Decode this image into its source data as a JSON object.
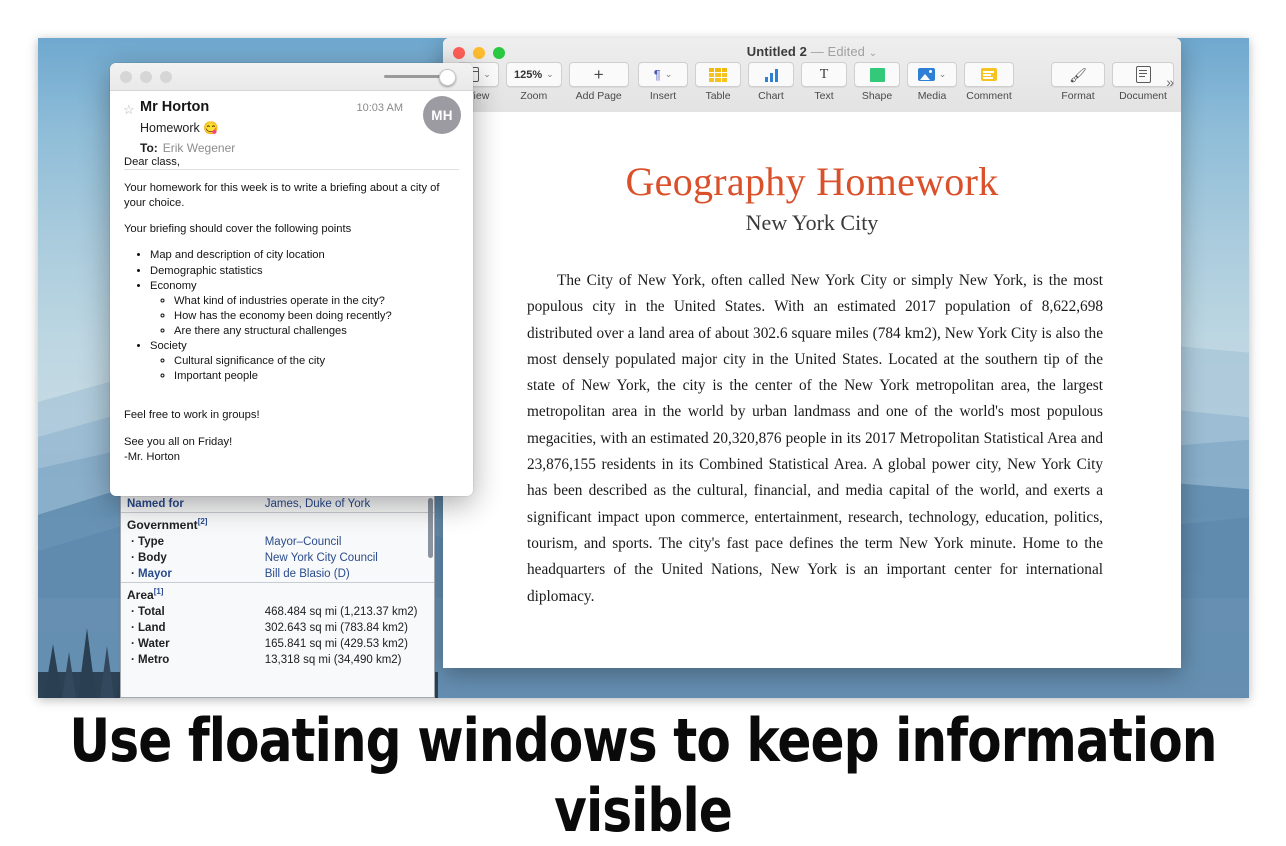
{
  "caption": "Use floating windows to keep information visible",
  "pages_app": {
    "window_title": "Untitled 2",
    "edited_status": "— Edited",
    "title_chevron": "⌄",
    "overflow_label": "»",
    "toolbar": [
      {
        "id": "view",
        "label": "View",
        "icon": "sidebar-view-icon",
        "has_chevron": true,
        "chevron": "⌄"
      },
      {
        "id": "zoom",
        "label": "Zoom",
        "icon": "zoom-level-icon",
        "value": "125%",
        "has_chevron": true,
        "chevron": "⌄"
      },
      {
        "id": "add-page",
        "label": "Add Page",
        "icon": "plus-icon",
        "glyph": "+",
        "has_chevron": false
      },
      {
        "id": "insert",
        "label": "Insert",
        "icon": "pilcrow-icon",
        "glyph": "¶",
        "has_chevron": true,
        "chevron": "⌄"
      },
      {
        "id": "table",
        "label": "Table",
        "icon": "table-grid-icon",
        "has_chevron": false
      },
      {
        "id": "chart",
        "label": "Chart",
        "icon": "bar-chart-icon",
        "has_chevron": false
      },
      {
        "id": "text",
        "label": "Text",
        "icon": "text-box-icon",
        "glyph": "T",
        "has_chevron": false
      },
      {
        "id": "shape",
        "label": "Shape",
        "icon": "green-square-icon",
        "has_chevron": false
      },
      {
        "id": "media",
        "label": "Media",
        "icon": "photo-icon",
        "has_chevron": true,
        "chevron": "⌄"
      },
      {
        "id": "comment",
        "label": "Comment",
        "icon": "sticky-note-icon",
        "has_chevron": false
      },
      {
        "id": "format",
        "label": "Format",
        "icon": "paintbrush-icon",
        "glyph": "🖌",
        "has_chevron": false
      },
      {
        "id": "document",
        "label": "Document",
        "icon": "document-icon",
        "has_chevron": false
      }
    ],
    "document": {
      "title": "Geography Homework",
      "title_color": "#d9502a",
      "subtitle": "New York City",
      "body": "The City of New York, often called New York City or simply New York, is the most populous city in the United States. With an estimated 2017 population of 8,622,698 distributed over a land area of about 302.6 square miles (784 km2), New York City is also the most densely populated major city in the United States. Located at the southern tip of the state of New York, the city is the center of the New York metropolitan area, the largest metropolitan area in the world by urban landmass and one of the world's most populous megacities, with an estimated 20,320,876 people in its 2017 Metropolitan Statistical Area and 23,876,155 residents in its Combined Statistical Area. A global power city, New York City has been described as the cultural, financial, and media capital of the world, and exerts a significant impact upon commerce, entertainment, research, technology, education, politics, tourism, and sports. The city's fast pace defines the term New York minute. Home to the headquarters of the United Nations, New York is an important center for international diplomacy."
    }
  },
  "mail_window": {
    "sender": "Mr Horton",
    "time": "10:03 AM",
    "avatar_initials": "MH",
    "subject": "Homework 😋",
    "to_label": "To:",
    "to_name": "Erik Wegener",
    "star_glyph": "☆",
    "body": {
      "greeting": "Dear class,",
      "para1": "Your homework for this week is to write a briefing about a city of your choice.",
      "para2": "Your briefing should cover the following points",
      "points": [
        {
          "text": "Map and description of city location",
          "sub": []
        },
        {
          "text": "Demographic statistics",
          "sub": []
        },
        {
          "text": "Economy",
          "sub": [
            "What kind of industries operate in the city?",
            "How has the economy been doing recently?",
            "Are there any structural challenges"
          ]
        },
        {
          "text": "Society",
          "sub": [
            "Cultural significance of the city",
            "Important people"
          ]
        }
      ],
      "closing1": "Feel free to work in groups!",
      "closing2": "See you all on Friday!",
      "signature": "-Mr. Horton"
    }
  },
  "infobox": {
    "rows": [
      {
        "key": "Named for",
        "key_link": true,
        "value": "James, Duke of York",
        "value_link": true,
        "indent": false,
        "section": false
      },
      {
        "key": "Government",
        "ref": "[2]",
        "value": "",
        "indent": false,
        "section": true
      },
      {
        "key": "Type",
        "value": "Mayor–Council",
        "value_link": true,
        "indent": true,
        "bullet": "·"
      },
      {
        "key": "Body",
        "value": "New York City Council",
        "value_link": true,
        "indent": true,
        "bullet": "·"
      },
      {
        "key": "Mayor",
        "key_link": true,
        "value": "Bill de Blasio (D)",
        "value_link": true,
        "indent": true,
        "bullet": "·"
      },
      {
        "key": "Area",
        "ref": "[1]",
        "value": "",
        "indent": false,
        "section": true
      },
      {
        "key": "Total",
        "value": "468.484 sq mi (1,213.37 km2)",
        "indent": true,
        "bullet": "·"
      },
      {
        "key": "Land",
        "value": "302.643 sq mi (783.84 km2)",
        "indent": true,
        "bullet": "·"
      },
      {
        "key": "Water",
        "value": "165.841 sq mi (429.53 km2)",
        "indent": true,
        "bullet": "·"
      },
      {
        "key": "Metro",
        "value": "13,318 sq mi (34,490 km2)",
        "indent": true,
        "bullet": "·"
      }
    ]
  }
}
